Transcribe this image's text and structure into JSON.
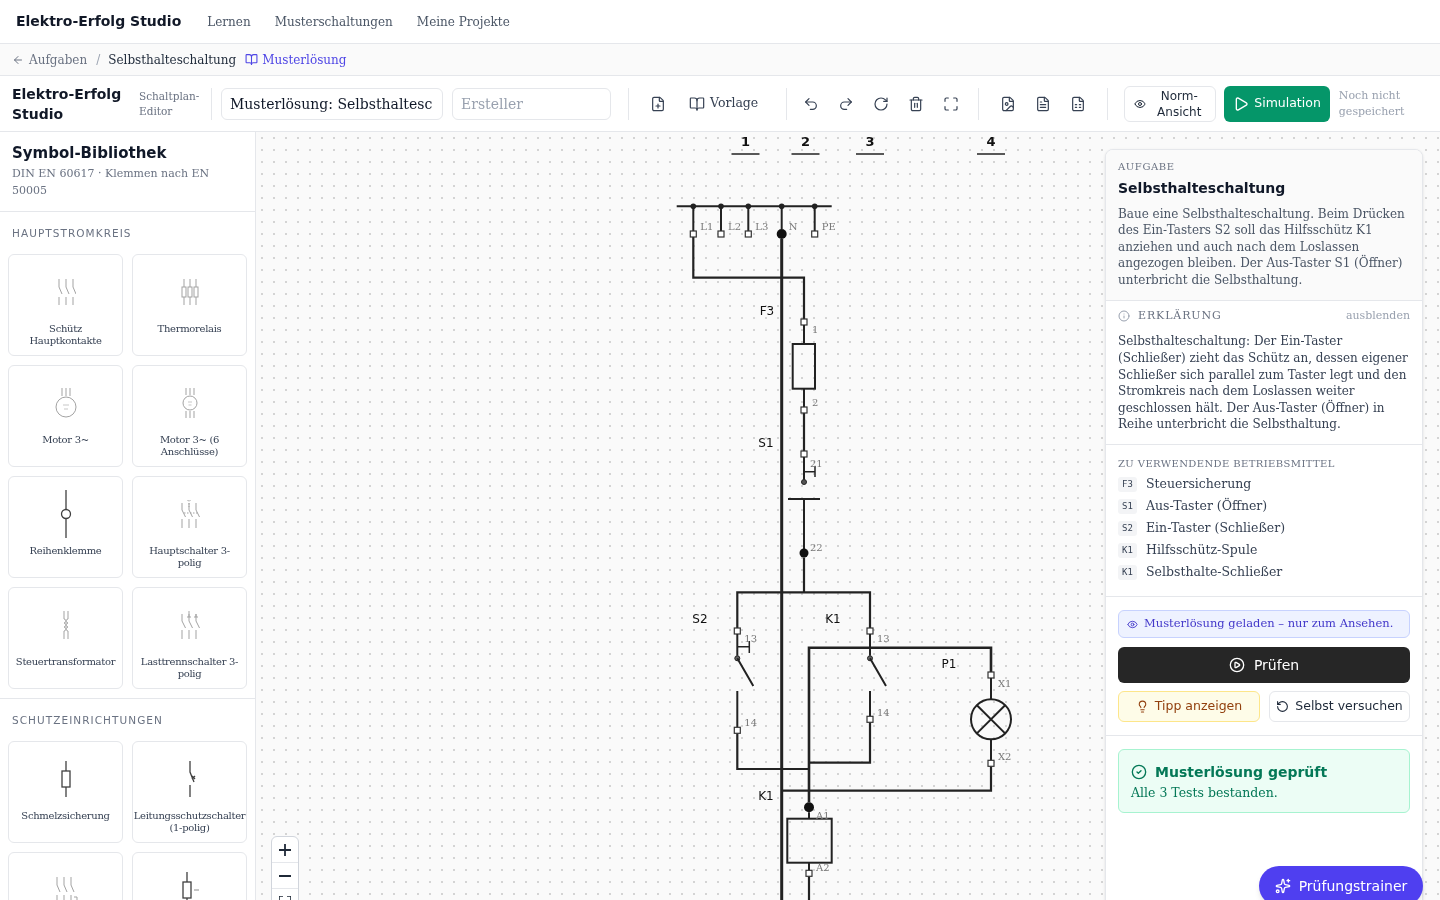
{
  "top_nav": {
    "brand": "Elektro-Erfolg Studio",
    "links": [
      "Lernen",
      "Musterschaltungen",
      "Meine Projekte"
    ]
  },
  "breadcrumb": {
    "back": "Aufgaben",
    "separator": "/",
    "current": "Selbsthalteschaltung",
    "link": "Musterlösung"
  },
  "toolbar": {
    "brand": "Elektro-Erfolg Studio",
    "subtitle": "Schaltplan-Editor",
    "title_field": {
      "value": "Musterlösung: Selbsthaltesc"
    },
    "author_field": {
      "placeholder": "Ersteller"
    },
    "template_button": "Vorlage",
    "norm_button": "Norm-Ansicht",
    "simulation_button": "Simulation",
    "save_status": "Noch nicht gespeichert"
  },
  "library": {
    "title": "Symbol-Bibliothek",
    "subtitle": "DIN EN 60617 · Klemmen nach EN 50005",
    "sections": [
      {
        "heading": "HAUPTSTROMKREIS",
        "items": [
          {
            "kind": "main_contacts",
            "label": "Schütz Hauptkontakte"
          },
          {
            "kind": "thermal",
            "label": "Thermorelais"
          },
          {
            "kind": "motor",
            "label": "Motor 3~"
          },
          {
            "kind": "motor6",
            "label": "Motor 3~ (6 Anschlüsse)"
          },
          {
            "kind": "terminal",
            "label": "Reihenklemme"
          },
          {
            "kind": "main_switch",
            "label": "Hauptschalter 3-polig"
          },
          {
            "kind": "transformer",
            "label": "Steuertransformator"
          },
          {
            "kind": "load_switch",
            "label": "Lasttrennschalter 3-polig"
          }
        ]
      },
      {
        "heading": "SCHUTZEINRICHTUNGEN",
        "items": [
          {
            "kind": "fuse",
            "label": "Schmelzsicherung"
          },
          {
            "kind": "mcb",
            "label": "Leitungsschutzschalter (1-polig)"
          },
          {
            "kind": "motor_protection"
          },
          {
            "kind": "fuse_base"
          }
        ]
      }
    ]
  },
  "canvas": {
    "columns": [
      "1",
      "2",
      "3",
      "4"
    ],
    "busbar": {
      "terminals": [
        "L1",
        "L2",
        "L3",
        "N",
        "PE"
      ]
    },
    "components": [
      {
        "tag": "F3",
        "kind": "fuse",
        "terminals": [
          "1",
          "2"
        ]
      },
      {
        "tag": "S1",
        "kind": "nc_button",
        "terminals": [
          "21",
          "22"
        ]
      },
      {
        "tag": "S2",
        "kind": "no_button",
        "terminals": [
          "13",
          "14"
        ]
      },
      {
        "tag": "K1",
        "kind": "no_contact",
        "terminals": [
          "13",
          "14"
        ]
      },
      {
        "tag": "P1",
        "kind": "lamp",
        "terminals": [
          "X1",
          "X2"
        ]
      },
      {
        "tag": "K1",
        "kind": "coil",
        "terminals": [
          "A1",
          "A2"
        ]
      }
    ]
  },
  "task_panel": {
    "task": {
      "label": "AUFGABE",
      "title": "Selbsthalteschaltung",
      "text": "Baue eine Selbsthalteschaltung. Beim Drücken des Ein-Tasters S2 soll das Hilfsschütz K1 anziehen und auch nach dem Loslassen angezogen bleiben. Der Aus-Taster S1 (Öffner) unterbricht die Selbsthaltung."
    },
    "explanation": {
      "label": "ERKLÄRUNG",
      "toggle": "ausblenden",
      "text": "Selbsthalteschaltung: Der Ein-Taster (Schließer) zieht das Schütz an, dessen eigener Schließer sich parallel zum Taster legt und den Stromkreis nach dem Loslassen weiter geschlossen hält. Der Aus-Taster (Öffner) in Reihe unterbricht die Selbsthaltung."
    },
    "equipment": {
      "label": "ZU VERWENDENDE BETRIEBSMITTEL",
      "items": [
        {
          "tag": "F3",
          "name": "Steuersicherung"
        },
        {
          "tag": "S1",
          "name": "Aus-Taster (Öffner)"
        },
        {
          "tag": "S2",
          "name": "Ein-Taster (Schließer)"
        },
        {
          "tag": "K1",
          "name": "Hilfsschütz-Spule"
        },
        {
          "tag": "K1",
          "name": "Selbsthalte-Schließer"
        }
      ]
    },
    "notice": "Musterlösung geladen – nur zum Ansehen.",
    "check_button": "Prüfen",
    "hint_button": "Tipp anzeigen",
    "retry_button": "Selbst versuchen",
    "result": {
      "title": "Musterlösung geprüft",
      "text": "Alle 3 Tests bestanden."
    }
  },
  "trainer_button": "Prüfungstrainer"
}
